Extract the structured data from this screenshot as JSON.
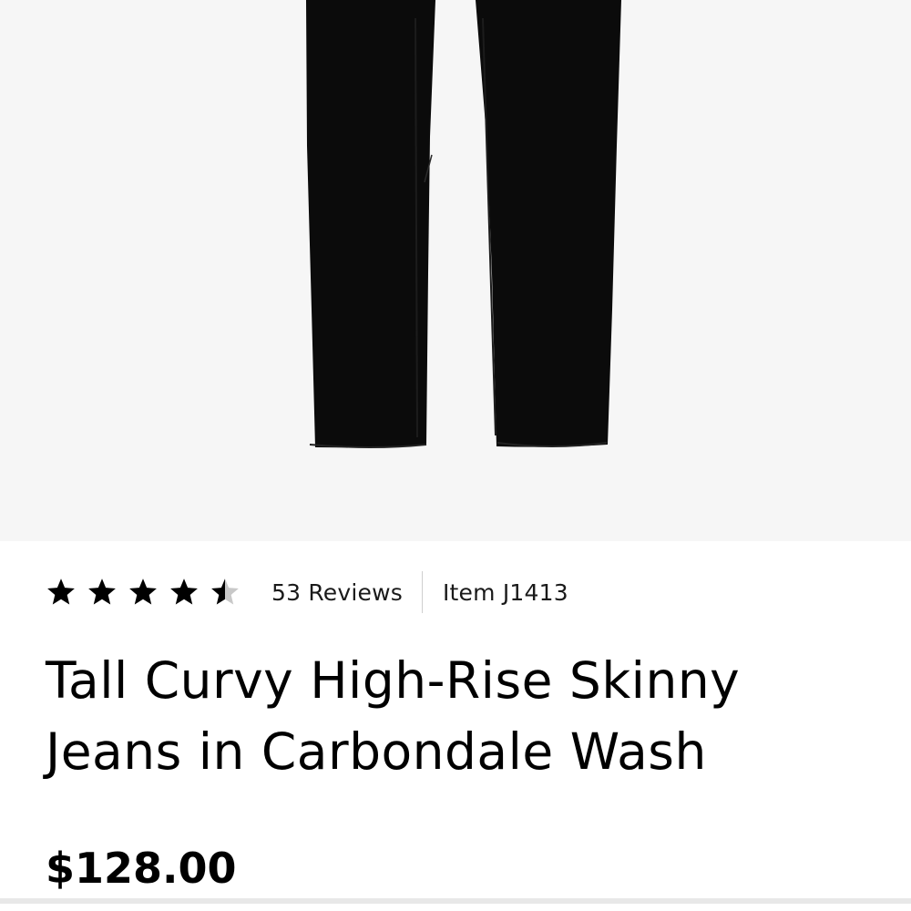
{
  "product": {
    "image_alt": "Tall Curvy High-Rise Skinny Jeans in Carbondale Wash",
    "rating": {
      "value": 4.5,
      "max": 5,
      "star_color": "#000000",
      "empty_star_color": "#c8c8c8"
    },
    "reviews_label": "53 Reviews",
    "item_number": "Item J1413",
    "title": "Tall Curvy High-Rise Skinny Jeans in Carbondale Wash",
    "price": "$128.00"
  },
  "colors": {
    "image_background": "#f6f6f6",
    "jeans": "#0b0b0b",
    "text": "#000000",
    "divider": "#cfcfcf"
  }
}
